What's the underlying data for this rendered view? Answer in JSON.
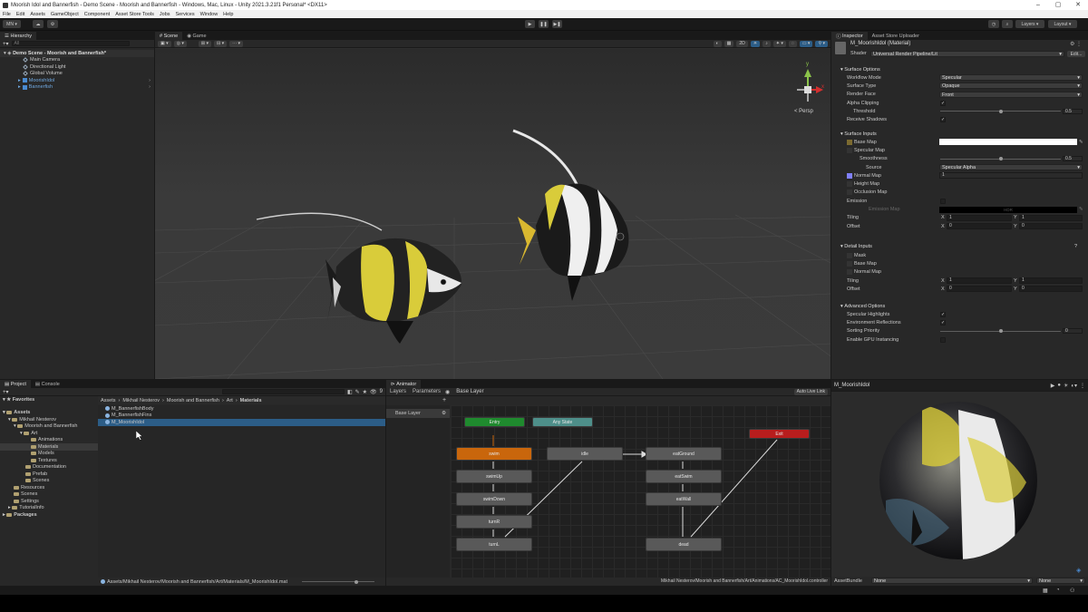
{
  "window": {
    "title": "Moorish Idol and Bannerfish - Demo Scene - Moorish and Bannerfish - Windows, Mac, Linux - Unity 2021.3.21f1 Personal* <DX11>"
  },
  "menu": [
    "File",
    "Edit",
    "Assets",
    "GameObject",
    "Component",
    "Asset Store Tools",
    "Jobs",
    "Services",
    "Window",
    "Help"
  ],
  "toolbar": {
    "account": "MN",
    "layers": "Layers",
    "layout": "Layout"
  },
  "hierarchy": {
    "tab": "Hierarchy",
    "search_placeholder": "All",
    "scene": "Demo Scene - Moorish and Bannerfish*",
    "items": [
      "Main Camera",
      "Directional Light",
      "Global Volume",
      "MoorishIdol",
      "Bannerfish"
    ]
  },
  "scene_view": {
    "tabs": [
      "Scene",
      "Game"
    ],
    "persp_label": "< Persp",
    "axes": {
      "y": "y",
      "x": "x",
      "z": "z"
    },
    "toggle_2d": "2D"
  },
  "inspector": {
    "tabs": [
      "Inspector",
      "Asset Store Uploader"
    ],
    "material_name": "M_MoorishIdol (Material)",
    "shader_label": "Shader",
    "shader_value": "Universal Render Pipeline/Lit",
    "edit_label": "Edit...",
    "surface_options": {
      "title": "Surface Options",
      "workflow_mode_label": "Workflow Mode",
      "workflow_mode": "Specular",
      "surface_type_label": "Surface Type",
      "surface_type": "Opaque",
      "render_face_label": "Render Face",
      "render_face": "Front",
      "alpha_clipping_label": "Alpha Clipping",
      "threshold_label": "Threshold",
      "threshold": "0.5",
      "receive_shadows_label": "Receive Shadows"
    },
    "surface_inputs": {
      "title": "Surface Inputs",
      "base_map": "Base Map",
      "specular_map": "Specular Map",
      "smoothness_label": "Smoothness",
      "smoothness": "0.5",
      "source_label": "Source",
      "source": "Specular Alpha",
      "normal_map": "Normal Map",
      "normal_value": "1",
      "height_map": "Height Map",
      "occlusion_map": "Occlusion Map",
      "emission_label": "Emission",
      "emission_map": "Emission Map",
      "hdr": "HDR",
      "tiling_label": "Tiling",
      "tiling_x": "1",
      "tiling_y": "1",
      "offset_label": "Offset",
      "offset_x": "0",
      "offset_y": "0"
    },
    "detail_inputs": {
      "title": "Detail Inputs",
      "mask": "Mask",
      "base_map": "Base Map",
      "normal_map": "Normal Map",
      "tiling_label": "Tiling",
      "tiling_x": "1",
      "tiling_y": "1",
      "offset_label": "Offset",
      "offset_x": "0",
      "offset_y": "0"
    },
    "advanced_options": {
      "title": "Advanced Options",
      "specular_highlights": "Specular Highlights",
      "environment_reflections": "Environment Reflections",
      "sorting_priority_label": "Sorting Priority",
      "sorting_priority": "0",
      "gpu_instancing": "Enable GPU Instancing"
    },
    "axis_x": "X",
    "axis_y": "Y"
  },
  "project": {
    "tabs": [
      "Project",
      "Console"
    ],
    "favorites": "Favorites",
    "assets": "Assets",
    "tree": [
      "Mikhail Nesterov",
      "Moorish and Bannerfish",
      "Art",
      "Animations",
      "Materials",
      "Models",
      "Textures",
      "Documentation",
      "Prefab",
      "Scenes",
      "Resources",
      "Scenes",
      "Settings",
      "TutorialInfo"
    ],
    "packages": "Packages",
    "breadcrumb": [
      "Assets",
      "Mikhail Nesterov",
      "Moorish and Bannerfish",
      "Art",
      "Materials"
    ],
    "files": [
      "M_BannerfishBody",
      "M_BannerfishFins",
      "M_MoorishIdol"
    ],
    "status_path": "Assets/Mikhail Nesterov/Moorish and Bannerfish/Art/Materials/M_MoorishIdol.mat",
    "hidden_count": "9"
  },
  "animator": {
    "tab": "Animator",
    "subtabs": [
      "Layers",
      "Parameters"
    ],
    "breadcrumb": "Base Layer",
    "layer_item": "Base Layer",
    "auto_live_link": "Auto Live Link",
    "nodes": {
      "entry": "Entry",
      "any_state": "Any State",
      "exit": "Exit",
      "swim": "swim",
      "swim_up": "swimUp",
      "swim_down": "swimDown",
      "turn_r": "turnR",
      "turn_l": "turnL",
      "idle": "idle",
      "eat_ground": "eatGround",
      "eat_swim": "eatSwim",
      "eat_wall": "eatWall",
      "dead": "dead"
    },
    "status_path": "Mikhail Nesterov/Moorish and Bannerfish/Art/Animations/AC_MoorishIdol.controller"
  },
  "preview": {
    "title": "M_MoorishIdol",
    "assetbundle_label": "AssetBundle",
    "assetbundle_value": "None",
    "variant_value": "None"
  },
  "colors": {
    "selection": "#2c5d87",
    "entry": "#1f8a2e",
    "any_state": "#4e8f8a",
    "exit": "#b81d1d",
    "default_state": "#c9660c",
    "accent": "#4a8ad0"
  }
}
